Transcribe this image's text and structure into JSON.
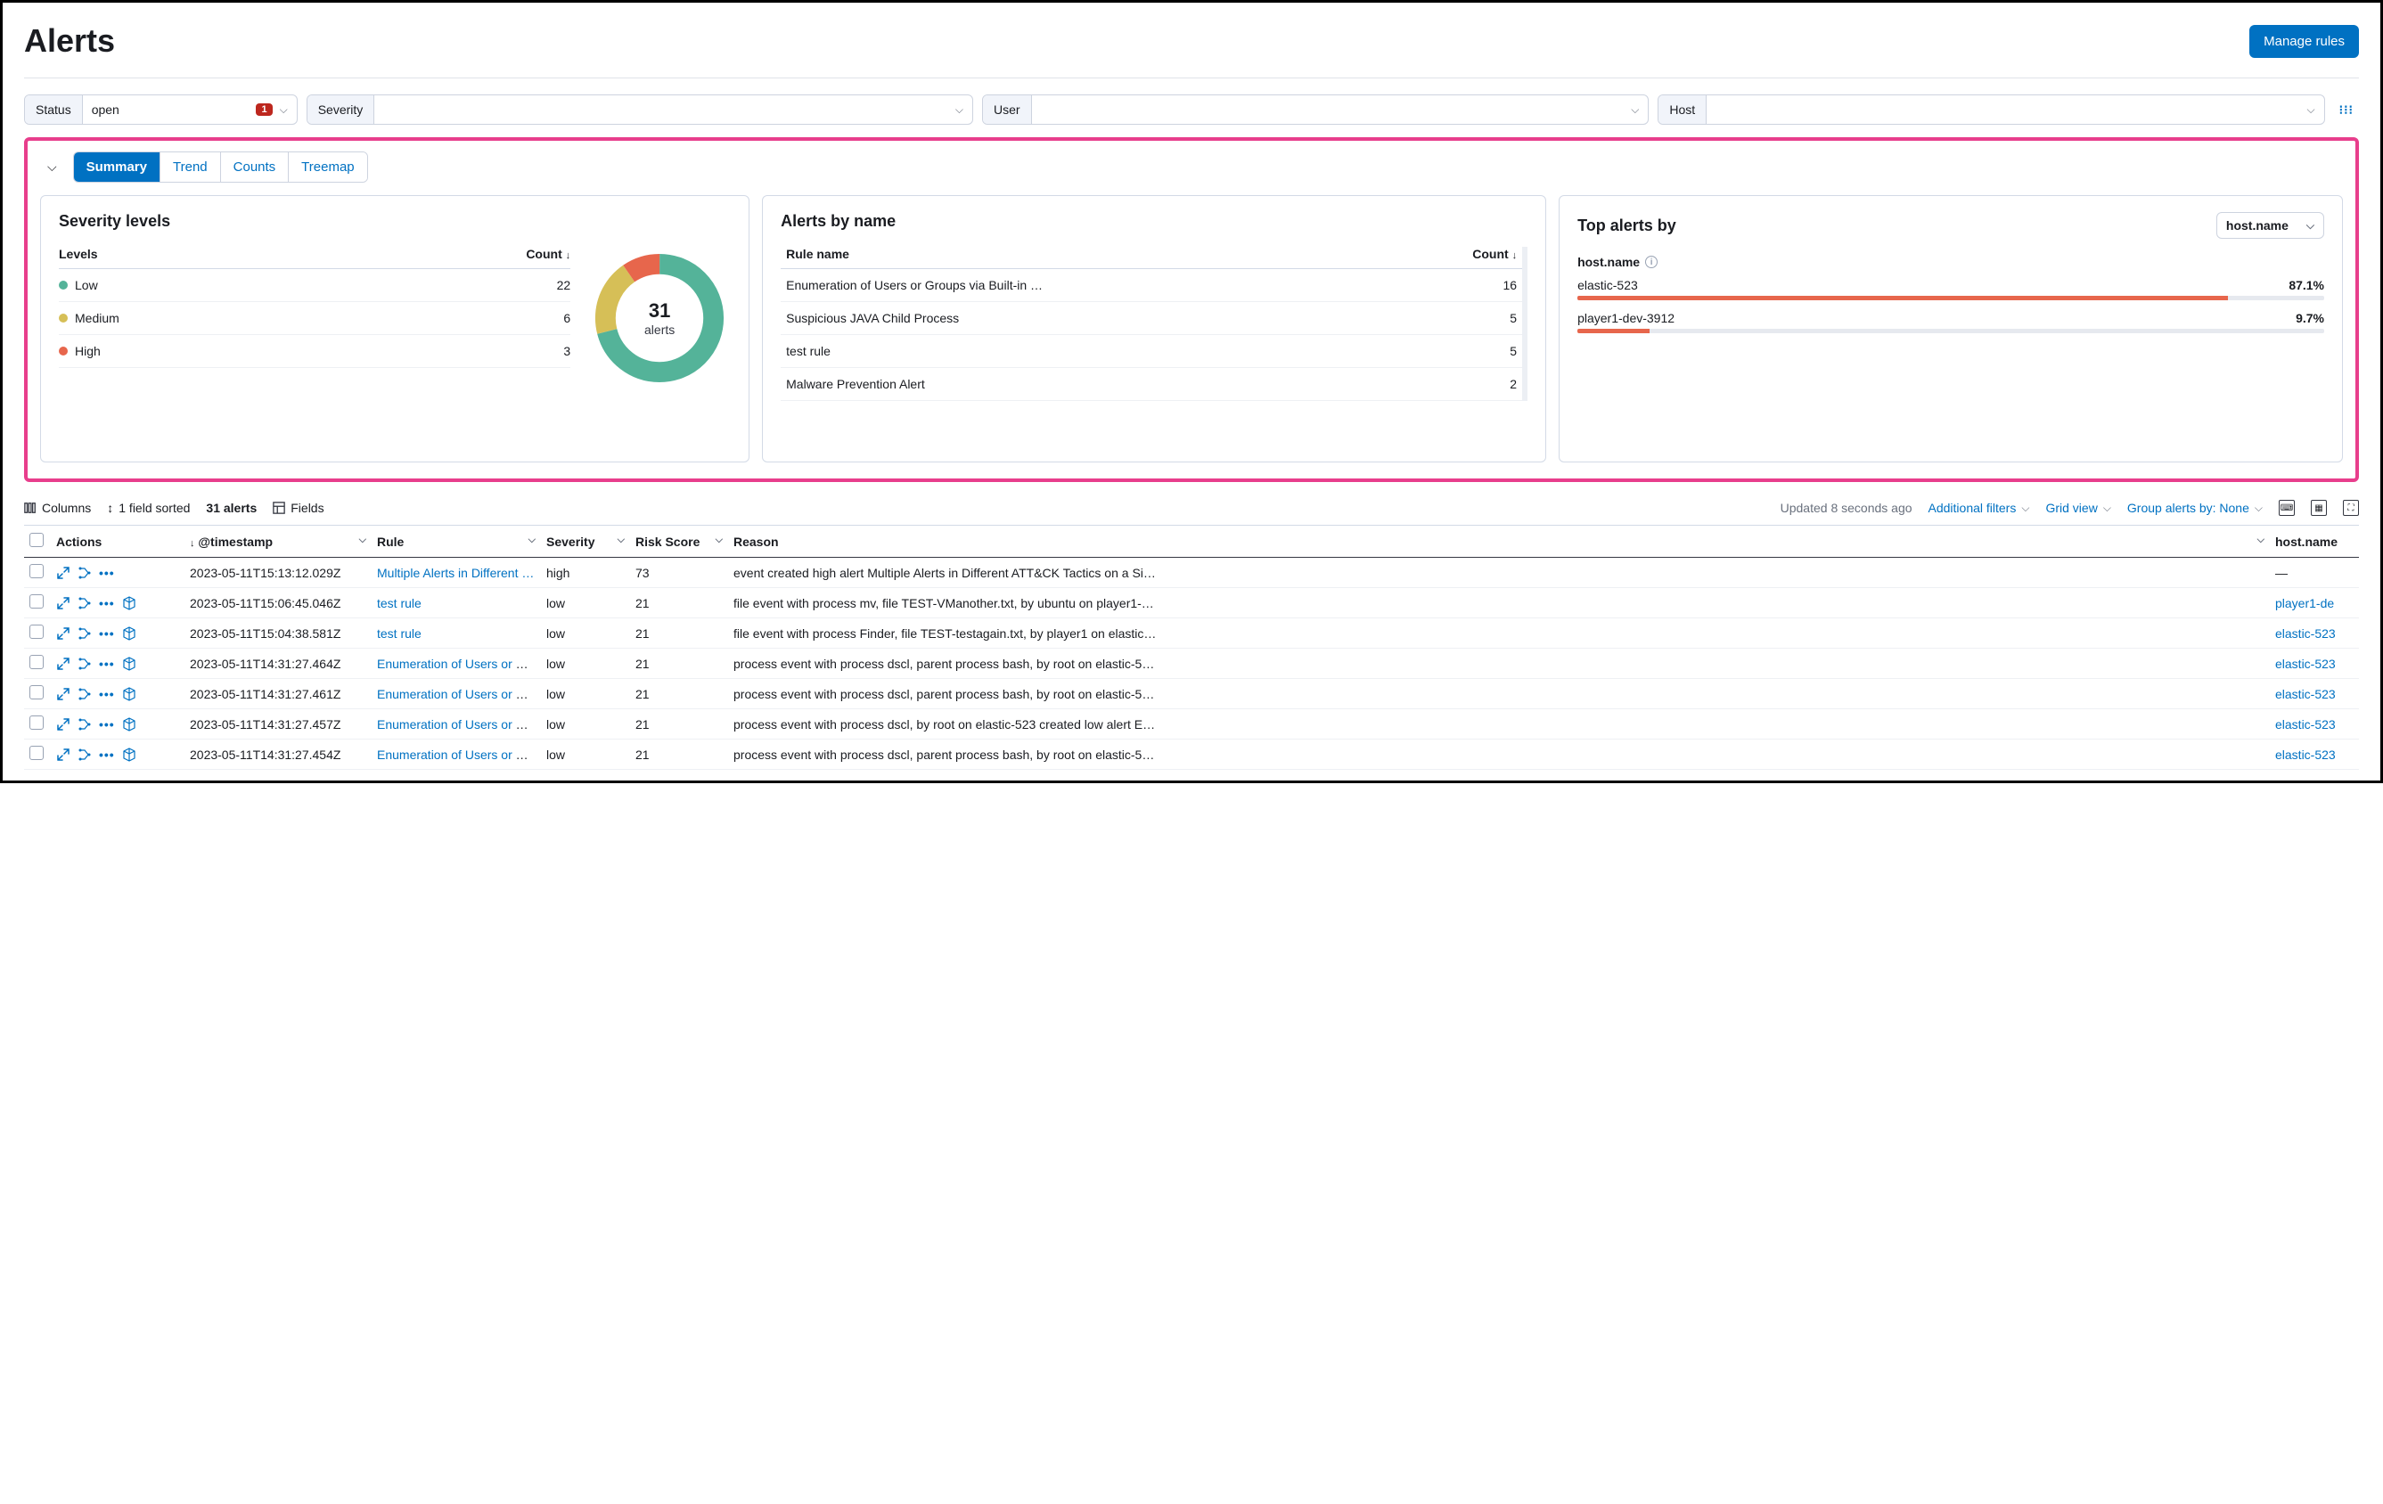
{
  "header": {
    "title": "Alerts",
    "manage_btn": "Manage rules"
  },
  "filters": {
    "status": {
      "label": "Status",
      "value": "open",
      "badge": "1"
    },
    "severity": {
      "label": "Severity",
      "value": ""
    },
    "user": {
      "label": "User",
      "value": ""
    },
    "host": {
      "label": "Host",
      "value": ""
    }
  },
  "tabs": {
    "summary": "Summary",
    "trend": "Trend",
    "counts": "Counts",
    "treemap": "Treemap"
  },
  "severity_card": {
    "title": "Severity levels",
    "col_levels": "Levels",
    "col_count": "Count",
    "rows": [
      {
        "label": "Low",
        "count": "22"
      },
      {
        "label": "Medium",
        "count": "6"
      },
      {
        "label": "High",
        "count": "3"
      }
    ],
    "total": "31",
    "total_label": "alerts"
  },
  "alerts_by_name": {
    "title": "Alerts by name",
    "col_rule": "Rule name",
    "col_count": "Count",
    "rows": [
      {
        "name": "Enumeration of Users or Groups via Built-in …",
        "count": "16"
      },
      {
        "name": "Suspicious JAVA Child Process",
        "count": "5"
      },
      {
        "name": "test rule",
        "count": "5"
      },
      {
        "name": "Malware Prevention Alert",
        "count": "2"
      }
    ]
  },
  "top_alerts": {
    "title": "Top alerts by",
    "select": "host.name",
    "group_label": "host.name",
    "rows": [
      {
        "name": "elastic-523",
        "pct": "87.1%",
        "w": 87.1
      },
      {
        "name": "player1-dev-3912",
        "pct": "9.7%",
        "w": 9.7
      }
    ]
  },
  "toolbar": {
    "columns": "Columns",
    "sorted": "1 field sorted",
    "count": "31 alerts",
    "fields": "Fields",
    "updated": "Updated 8 seconds ago",
    "add_filters": "Additional filters",
    "grid_view": "Grid view",
    "group_by": "Group alerts by: None"
  },
  "table": {
    "cols": {
      "actions": "Actions",
      "ts": "@timestamp",
      "rule": "Rule",
      "severity": "Severity",
      "risk": "Risk Score",
      "reason": "Reason",
      "host": "host.name"
    },
    "rows": [
      {
        "ts": "2023-05-11T15:13:12.029Z",
        "rule": "Multiple Alerts in Different …",
        "sev": "high",
        "risk": "73",
        "reason": "event created high alert Multiple Alerts in Different ATT&CK Tactics on a Si…",
        "host": "—",
        "cube": false
      },
      {
        "ts": "2023-05-11T15:06:45.046Z",
        "rule": "test rule",
        "sev": "low",
        "risk": "21",
        "reason": "file event with process mv, file TEST-VManother.txt, by ubuntu on player1-…",
        "host": "player1-de",
        "cube": true
      },
      {
        "ts": "2023-05-11T15:04:38.581Z",
        "rule": "test rule",
        "sev": "low",
        "risk": "21",
        "reason": "file event with process Finder, file TEST-testagain.txt, by player1 on elastic…",
        "host": "elastic-523",
        "cube": true
      },
      {
        "ts": "2023-05-11T14:31:27.464Z",
        "rule": "Enumeration of Users or Gr…",
        "sev": "low",
        "risk": "21",
        "reason": "process event with process dscl, parent process bash, by root on elastic-5…",
        "host": "elastic-523",
        "cube": true
      },
      {
        "ts": "2023-05-11T14:31:27.461Z",
        "rule": "Enumeration of Users or Gr…",
        "sev": "low",
        "risk": "21",
        "reason": "process event with process dscl, parent process bash, by root on elastic-5…",
        "host": "elastic-523",
        "cube": true
      },
      {
        "ts": "2023-05-11T14:31:27.457Z",
        "rule": "Enumeration of Users or Gr…",
        "sev": "low",
        "risk": "21",
        "reason": "process event with process dscl, by root on elastic-523 created low alert E…",
        "host": "elastic-523",
        "cube": true
      },
      {
        "ts": "2023-05-11T14:31:27.454Z",
        "rule": "Enumeration of Users or Gr…",
        "sev": "low",
        "risk": "21",
        "reason": "process event with process dscl, parent process bash, by root on elastic-5…",
        "host": "elastic-523",
        "cube": true
      }
    ]
  },
  "chart_data": {
    "type": "pie",
    "title": "Severity levels",
    "categories": [
      "Low",
      "Medium",
      "High"
    ],
    "values": [
      22,
      6,
      3
    ],
    "colors": [
      "#54b399",
      "#d6bf57",
      "#e7664c"
    ],
    "total": 31
  }
}
